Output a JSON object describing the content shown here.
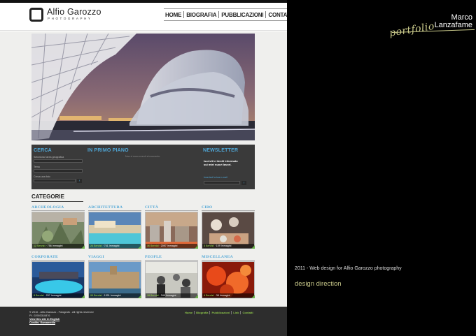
{
  "site": {
    "logo": {
      "name": "Alfio Garozzo",
      "subtitle": "PHOTOGRAPHY"
    },
    "nav": [
      "HOME",
      "BIOGRAFIA",
      "PUBBLICAZIONI",
      "CONTATTI"
    ],
    "band": {
      "cerca": {
        "title": "CERCA",
        "label_area": "Seleziona l'area geografica",
        "label_tema": "Tema",
        "label_testo": "Cerca una foto",
        "go": "›"
      },
      "primo_piano": {
        "title": "IN PRIMO PIANO",
        "empty": "Non ci sono eventi al momento"
      },
      "newsletter": {
        "title": "NEWSLETTER",
        "text_1": "Iscriviti e tieniti informato",
        "text_2": "sui miei nuovi lavori.",
        "link": "Inserisci la tua e-mail",
        "go": "›"
      }
    },
    "categories_title": "CATEGORIE",
    "categories": [
      {
        "name": "ARCHEOLOGIA",
        "services": "12 Servizi",
        "images": "756 Immagini"
      },
      {
        "name": "ARCHITETTURA",
        "services": "24 Servizi",
        "images": "741 Immagini"
      },
      {
        "name": "CITTÀ",
        "services": "36 Servizi",
        "images": "2097 Immagini"
      },
      {
        "name": "CIBO",
        "services": "3 Servizi",
        "images": "109 Immagini"
      },
      {
        "name": "CORPORATE",
        "services": "8 Servizi",
        "images": "257 Immagini"
      },
      {
        "name": "VIAGGI",
        "services": "26 Servizi",
        "images": "1301 Immagini"
      },
      {
        "name": "PEOPLE",
        "services": "18 Servizi",
        "images": "346 Immagini"
      },
      {
        "name": "MISCELLANEA",
        "services": "4 Servizi",
        "images": "38 Immagini"
      }
    ],
    "footer": {
      "copyright": "© 2010 - Alfio Garozzo - Fotografo - All rights reserved",
      "piva": "P.I. 02903310876",
      "english": "View this site in English",
      "credits": "Credits: Gamamedia",
      "nav": [
        "Home",
        "Biografia",
        "Pubblicazioni",
        "Link",
        "Contatti"
      ]
    }
  },
  "portfolio": {
    "name_first": "Marco",
    "name_last": "Lanzafame",
    "script": "portfolio",
    "caption": "2011 - Web design for Alfio Garozzo photography",
    "role": "design direction"
  },
  "colors": {
    "accent_blue": "#4fa6d6",
    "accent_green": "#8bc34a",
    "gold": "#c9c98a"
  }
}
